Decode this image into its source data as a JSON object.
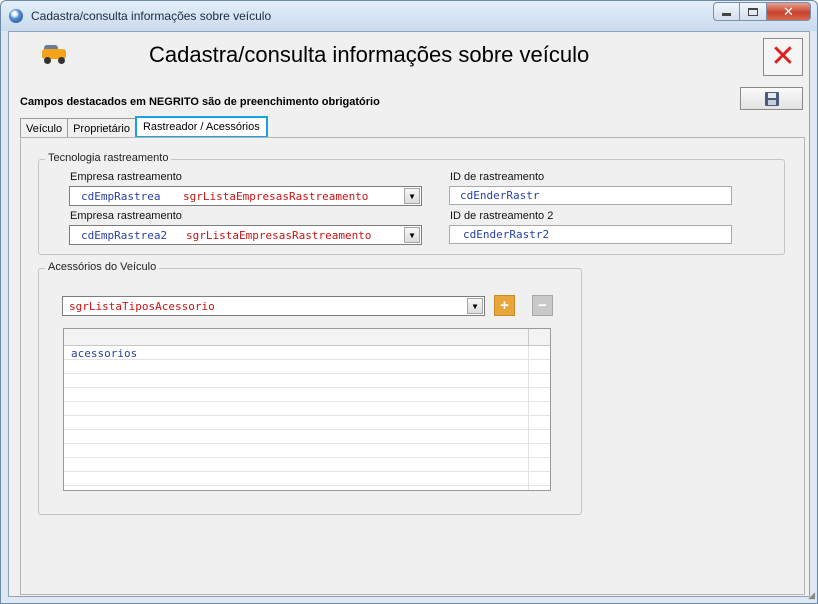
{
  "window": {
    "title": "Cadastra/consulta informações sobre veículo",
    "close_glyph": "✕"
  },
  "header": {
    "title": "Cadastra/consulta informações sobre veículo",
    "close_glyph": "✕",
    "icon": "vehicle-icon"
  },
  "required_note": "Campos destacados em NEGRITO são de preenchimento obrigatório",
  "save_icon": "floppy-disk-icon",
  "tabs": [
    {
      "label": "Veículo",
      "active": false
    },
    {
      "label": "Proprietário",
      "active": false
    },
    {
      "label": "Rastreador / Acessórios",
      "active": true
    }
  ],
  "tracking": {
    "legend": "Tecnologia rastreamento",
    "company1": {
      "label": "Empresa rastreamento",
      "code": "cdEmpRastrea",
      "list": "sgrListaEmpresasRastreamento"
    },
    "company2": {
      "label": "Empresa rastreamento",
      "code": "cdEmpRastrea2",
      "list": "sgrListaEmpresasRastreamento"
    },
    "id1": {
      "label": "ID de rastreamento",
      "value": "cdEnderRastr"
    },
    "id2": {
      "label": "ID de rastreamento 2",
      "value": "cdEnderRastr2"
    }
  },
  "accessories": {
    "legend": "Acessórios do Veículo",
    "type_select": "sgrListaTiposAcessorio",
    "add_glyph": "+",
    "remove_glyph": "−",
    "grid_rows": [
      {
        "value": "acessorios"
      }
    ]
  },
  "colors": {
    "field_code": "#2a3fa8",
    "field_list": "#c81414",
    "active_tab_border": "#1aa1e3",
    "add_button": "#e7a63b"
  }
}
